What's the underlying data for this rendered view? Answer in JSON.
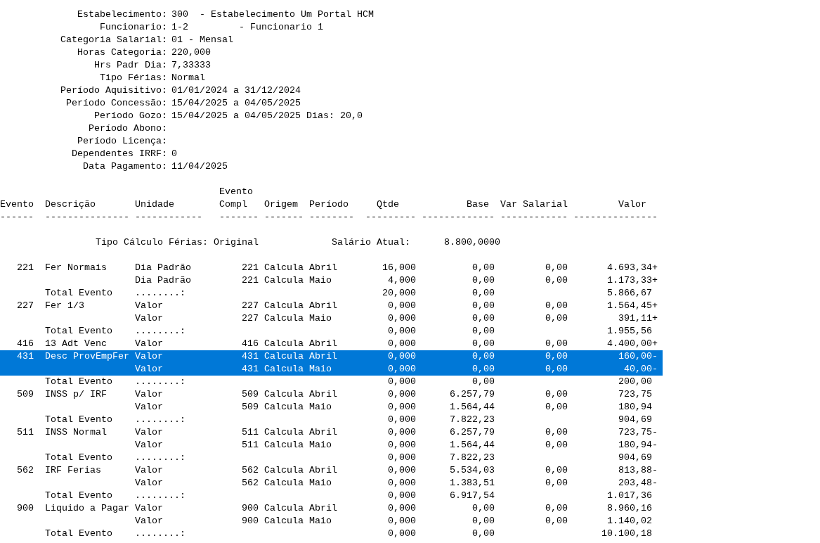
{
  "header_fields": [
    {
      "label": "Estabelecimento:",
      "value": "300  - Estabelecimento Um Portal HCM"
    },
    {
      "label": "Funcionario:",
      "value": "1-2         - Funcionario 1"
    },
    {
      "label": "Categoria Salarial:",
      "value": "01 - Mensal"
    },
    {
      "label": "Horas Categoria:",
      "value": "220,000"
    },
    {
      "label": "Hrs Padr Dia:",
      "value": "7,33333"
    },
    {
      "label": "Tipo Férias:",
      "value": "Normal"
    },
    {
      "label": "Período Aquisitivo:",
      "value": "01/01/2024 a 31/12/2024"
    },
    {
      "label": "Período Concessão:",
      "value": "15/04/2025 a 04/05/2025"
    },
    {
      "label": "Período Gozo:",
      "value": "15/04/2025 a 04/05/2025 Dias: 20,0"
    },
    {
      "label": "Período Abono:"
    },
    {
      "label": "Período Licença:"
    },
    {
      "label": "Dependentes IRRF:",
      "value": "0"
    },
    {
      "label": "Data Pagamento:",
      "value": "11/04/2025"
    }
  ],
  "table": {
    "columns": [
      {
        "label": "Evento",
        "rule": "------"
      },
      {
        "label": "Descrição",
        "rule": "---------------"
      },
      {
        "label": "Unidade",
        "rule": "------------"
      },
      {
        "label": "Evento Compl",
        "rule": "-------"
      },
      {
        "label": "Origem",
        "rule": "-------"
      },
      {
        "label": "Período",
        "rule": "--------"
      },
      {
        "label": "Qtde",
        "rule": "---------"
      },
      {
        "label": "Base",
        "rule": "-------------"
      },
      {
        "label": "Var Salarial",
        "rule": "------------"
      },
      {
        "label": "Valor",
        "rule": "---------------"
      }
    ],
    "summary": [
      {
        "label": "Tipo Cálculo Férias:",
        "value": "Original"
      },
      {
        "label": "Salário Atual:",
        "value": "8.800,0000"
      }
    ],
    "rows": [
      {
        "selected": false,
        "evento": "221",
        "descricao": "Fer Normais",
        "unidade": "Dia Padrão",
        "compl": "221",
        "origem": "Calcula",
        "periodo": "Abril",
        "qtde": "16,000",
        "base": "0,00",
        "var_salarial": "0,00",
        "valor": "4.693,34+"
      },
      {
        "selected": false,
        "unidade": "Dia Padrão",
        "compl": "221",
        "origem": "Calcula",
        "periodo": "Maio",
        "qtde": "4,000",
        "base": "0,00",
        "var_salarial": "0,00",
        "valor": "1.173,33+"
      },
      {
        "selected": false,
        "descricao": "Total Evento",
        "unidade": "........:",
        "qtde": "20,000",
        "base": "0,00",
        "valor": "5.866,67"
      },
      {
        "selected": false,
        "evento": "227",
        "descricao": "Fer 1/3",
        "unidade": "Valor",
        "compl": "227",
        "origem": "Calcula",
        "periodo": "Abril",
        "qtde": "0,000",
        "base": "0,00",
        "var_salarial": "0,00",
        "valor": "1.564,45+"
      },
      {
        "selected": false,
        "unidade": "Valor",
        "compl": "227",
        "origem": "Calcula",
        "periodo": "Maio",
        "qtde": "0,000",
        "base": "0,00",
        "var_salarial": "0,00",
        "valor": "391,11+"
      },
      {
        "selected": false,
        "descricao": "Total Evento",
        "unidade": "........:",
        "qtde": "0,000",
        "base": "0,00",
        "valor": "1.955,56"
      },
      {
        "selected": false,
        "evento": "416",
        "descricao": "13 Adt Venc",
        "unidade": "Valor",
        "compl": "416",
        "origem": "Calcula",
        "periodo": "Abril",
        "qtde": "0,000",
        "base": "0,00",
        "var_salarial": "0,00",
        "valor": "4.400,00+"
      },
      {
        "selected": true,
        "evento": "431",
        "descricao": "Desc ProvEmpFer",
        "unidade": "Valor",
        "compl": "431",
        "origem": "Calcula",
        "periodo": "Abril",
        "qtde": "0,000",
        "base": "0,00",
        "var_salarial": "0,00",
        "valor": "160,00-"
      },
      {
        "selected": true,
        "unidade": "Valor",
        "compl": "431",
        "origem": "Calcula",
        "periodo": "Maio",
        "qtde": "0,000",
        "base": "0,00",
        "var_salarial": "0,00",
        "valor": "40,00-"
      },
      {
        "selected": false,
        "descricao": "Total Evento",
        "unidade": "........:",
        "qtde": "0,000",
        "base": "0,00",
        "valor": "200,00"
      },
      {
        "selected": false,
        "evento": "509",
        "descricao": "INSS p/ IRF",
        "unidade": "Valor",
        "compl": "509",
        "origem": "Calcula",
        "periodo": "Abril",
        "qtde": "0,000",
        "base": "6.257,79",
        "var_salarial": "0,00",
        "valor": "723,75"
      },
      {
        "selected": false,
        "unidade": "Valor",
        "compl": "509",
        "origem": "Calcula",
        "periodo": "Maio",
        "qtde": "0,000",
        "base": "1.564,44",
        "var_salarial": "0,00",
        "valor": "180,94"
      },
      {
        "selected": false,
        "descricao": "Total Evento",
        "unidade": "........:",
        "qtde": "0,000",
        "base": "7.822,23",
        "valor": "904,69"
      },
      {
        "selected": false,
        "evento": "511",
        "descricao": "INSS Normal",
        "unidade": "Valor",
        "compl": "511",
        "origem": "Calcula",
        "periodo": "Abril",
        "qtde": "0,000",
        "base": "6.257,79",
        "var_salarial": "0,00",
        "valor": "723,75-"
      },
      {
        "selected": false,
        "unidade": "Valor",
        "compl": "511",
        "origem": "Calcula",
        "periodo": "Maio",
        "qtde": "0,000",
        "base": "1.564,44",
        "var_salarial": "0,00",
        "valor": "180,94-"
      },
      {
        "selected": false,
        "descricao": "Total Evento",
        "unidade": "........:",
        "qtde": "0,000",
        "base": "7.822,23",
        "valor": "904,69"
      },
      {
        "selected": false,
        "evento": "562",
        "descricao": "IRF Ferias",
        "unidade": "Valor",
        "compl": "562",
        "origem": "Calcula",
        "periodo": "Abril",
        "qtde": "0,000",
        "base": "5.534,03",
        "var_salarial": "0,00",
        "valor": "813,88-"
      },
      {
        "selected": false,
        "unidade": "Valor",
        "compl": "562",
        "origem": "Calcula",
        "periodo": "Maio",
        "qtde": "0,000",
        "base": "1.383,51",
        "var_salarial": "0,00",
        "valor": "203,48-"
      },
      {
        "selected": false,
        "descricao": "Total Evento",
        "unidade": "........:",
        "qtde": "0,000",
        "base": "6.917,54",
        "valor": "1.017,36"
      },
      {
        "selected": false,
        "evento": "900",
        "descricao": "Liquido a Pagar",
        "unidade": "Valor",
        "compl": "900",
        "origem": "Calcula",
        "periodo": "Abril",
        "qtde": "0,000",
        "base": "0,00",
        "var_salarial": "0,00",
        "valor": "8.960,16"
      },
      {
        "selected": false,
        "unidade": "Valor",
        "compl": "900",
        "origem": "Calcula",
        "periodo": "Maio",
        "qtde": "0,000",
        "base": "0,00",
        "var_salarial": "0,00",
        "valor": "1.140,02"
      },
      {
        "selected": false,
        "descricao": "Total Evento",
        "unidade": "........:",
        "qtde": "0,000",
        "base": "0,00",
        "valor": "10.100,18"
      }
    ]
  }
}
